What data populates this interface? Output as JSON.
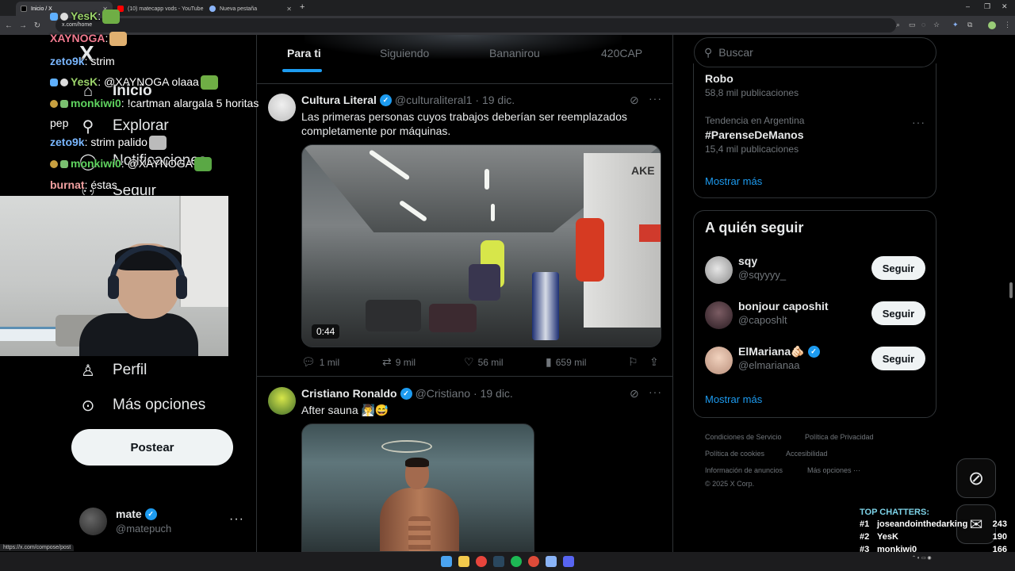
{
  "browser": {
    "tabs": [
      {
        "label": "Inicio / X",
        "active": true
      },
      {
        "label": "(10) matecapp vods - YouTube",
        "active": false
      },
      {
        "label": "Nueva pestaña",
        "active": false
      }
    ],
    "url": "x.com/home",
    "status_url": "https://x.com/compose/post"
  },
  "chat_overlay": [
    {
      "user": "YesK",
      "message": ":",
      "user_color": "#9bd36a"
    },
    {
      "user": "XAYNOGA",
      "message": ":",
      "user_color": "#f07a8f"
    },
    {
      "user": "zeto9k",
      "message": ": strim",
      "user_color": "#7ab7ff"
    },
    {
      "user": "YesK",
      "message": ": @XAYNOGA olaaa",
      "user_color": "#9bd36a"
    },
    {
      "user": "monkiwi0",
      "message": ": !cartman alargala 5 horitas",
      "user_color": "#5fd35f"
    },
    {
      "user": "",
      "message": "pep",
      "user_color": "#ffffff"
    },
    {
      "user": "zeto9k",
      "message": ": strim palido",
      "user_color": "#7ab7ff"
    },
    {
      "user": "monkiwi0",
      "message": ": @XAYNOGA",
      "user_color": "#5fd35f"
    },
    {
      "user": "burnat",
      "message": ": éstas",
      "user_color": "#f0a0a0"
    }
  ],
  "nav": {
    "logo": "X",
    "items": [
      {
        "label": "Inicio",
        "icon": "home-icon"
      },
      {
        "label": "Explorar",
        "icon": "search-icon"
      },
      {
        "label": "Notificaciones",
        "icon": "bell-icon"
      },
      {
        "label": "Seguir",
        "icon": "follow-icon"
      },
      {
        "label": "Perfil",
        "icon": "person-icon"
      },
      {
        "label": "Más opciones",
        "icon": "more-circle-icon"
      }
    ],
    "post_button": "Postear",
    "account": {
      "name": "mate",
      "handle": "@matepuch"
    }
  },
  "feed": {
    "tabs": [
      "Para ti",
      "Siguiendo",
      "Bananirou",
      "420CAP"
    ],
    "active_tab": "Para ti",
    "posts": [
      {
        "name": "Cultura Literal",
        "handle": "@culturaliteral1",
        "date": "· 19 dic.",
        "text": "Las primeras personas cuyos trabajos deberían ser reemplazados completamente por máquinas.",
        "media_duration": "0:44",
        "media_label": "AKE",
        "replies": "1 mil",
        "reposts": "9 mil",
        "likes": "56 mil",
        "views": "659 mil"
      },
      {
        "name": "Cristiano Ronaldo",
        "handle": "@Cristiano",
        "date": "· 19 dic.",
        "text": "After sauna 🧖‍♂️😅"
      }
    ]
  },
  "sidebar": {
    "search_placeholder": "Buscar",
    "trends": [
      {
        "context": "",
        "title": "Robo",
        "count": "58,8 mil publicaciones"
      },
      {
        "context": "Tendencia en Argentina",
        "title": "#ParenseDeManos",
        "count": "15,4 mil publicaciones"
      }
    ],
    "show_more": "Mostrar más",
    "who_to_follow": {
      "title": "A quién seguir",
      "users": [
        {
          "name": "sqy",
          "handle": "@sqyyyy_",
          "verified": false,
          "button": "Seguir"
        },
        {
          "name": "bonjour caposhit",
          "handle": "@caposhlt",
          "verified": false,
          "button": "Seguir"
        },
        {
          "name": "ElMariana🫵🏻",
          "handle": "@elmarianaa",
          "verified": true,
          "button": "Seguir"
        }
      ],
      "show_more": "Mostrar más"
    },
    "footer": {
      "links": [
        "Condiciones de Servicio",
        "Política de Privacidad",
        "Política de cookies",
        "Accesibilidad",
        "Información de anuncios",
        "Más opciones ···"
      ],
      "copyright": "© 2025 X Corp."
    }
  },
  "top_chatters": {
    "title": "TOP CHATTERS:",
    "rows": [
      {
        "rank": "#1",
        "user": "joseandointhedarking",
        "count": "243"
      },
      {
        "rank": "#2",
        "user": "YesK",
        "count": "190"
      },
      {
        "rank": "#3",
        "user": "monkiwi0",
        "count": "166"
      }
    ]
  },
  "colors": {
    "accent": "#1d9bf0",
    "background": "#000000",
    "text": "#e7e9ea",
    "muted": "#71767b",
    "border": "#2f3336"
  }
}
